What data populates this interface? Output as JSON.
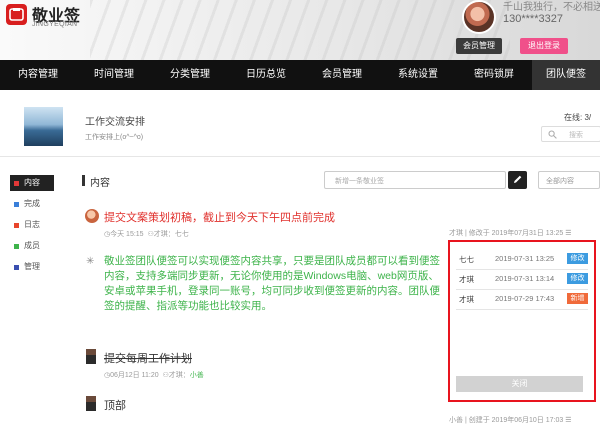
{
  "brand": {
    "name": "敬业签",
    "sub": "JINGYEQIAN",
    "tagline": "千山我独行，不必相送",
    "phone": "130****3327",
    "member_btn": "会员管理",
    "logout_btn": "退出登录"
  },
  "nav": [
    "内容管理",
    "时间管理",
    "分类管理",
    "日历总览",
    "会员管理",
    "系统设置",
    "密码锁屏",
    "团队便签"
  ],
  "team": {
    "name": "工作交流安排",
    "desc": "工作安排上(o^~^o)",
    "online": "在线: 3/",
    "search_placeholder": "搜索"
  },
  "sidebar": [
    {
      "label": "内容",
      "color": "#e23838",
      "active": true
    },
    {
      "label": "完成",
      "color": "#3a7fd9",
      "active": false
    },
    {
      "label": "日志",
      "color": "#e8452c",
      "active": false
    },
    {
      "label": "成员",
      "color": "#3db34a",
      "active": false
    },
    {
      "label": "管理",
      "color": "#3a4fb0",
      "active": false
    }
  ],
  "content": {
    "title": "内容",
    "new_placeholder": "新增一条敬业签",
    "filter": "全部内容"
  },
  "notes": [
    {
      "title": "提交文案策划初稿，截止到今天下午四点前完成",
      "meta_time": "今天 15:15",
      "meta_author": "才琪：七七",
      "right_prefix": "才琪",
      "right_label": "修改于 2019年07月31日 13:25"
    },
    {
      "body": "敬业签团队便签可以实现便签内容共享，只要是团队成员都可以看到便签内容，支持多端同步更新，无论你使用的是Windows电脑、web网页版、安卓或苹果手机，登录同一账号，均可同步收到便签更新的内容。团队便签的提醒、指派等功能也比较实用。"
    },
    {
      "title": "提交每周工作计划",
      "meta_time": "06月12日 11:20",
      "meta_author": "才琪：",
      "meta_assignee": "小善"
    },
    {
      "title": "顶部",
      "right_prefix": "小善",
      "right_label": "创建于 2019年06月10日 17:03"
    }
  ],
  "history": [
    {
      "who": "七七",
      "when": "2019-07-31 13:25",
      "tag": "修改",
      "tag_color": "#3c9be0"
    },
    {
      "who": "才琪",
      "when": "2019-07-31 13:14",
      "tag": "修改",
      "tag_color": "#3c9be0"
    },
    {
      "who": "才琪",
      "when": "2019-07-29 17:43",
      "tag": "新增",
      "tag_color": "#f06a3a"
    }
  ],
  "popup_close": "关闭"
}
